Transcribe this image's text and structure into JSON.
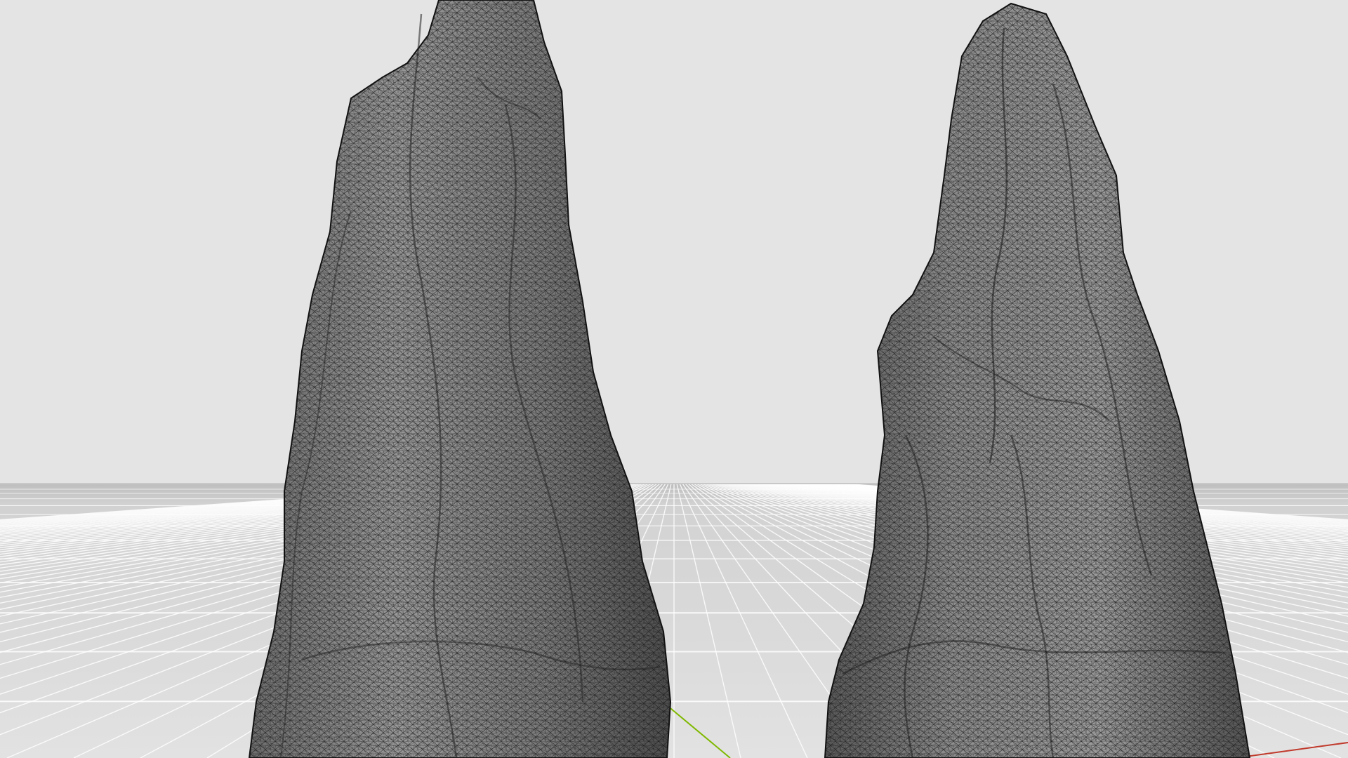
{
  "viewport": {
    "view_mode": "wireframe-shaded",
    "background_color": "#e4e4e4",
    "ground_color": "#d6d6d6",
    "grid_line_color": "#ffffff",
    "mesh_fill_color": "#8c8c8c",
    "mesh_wire_color": "#141414",
    "axes": {
      "x_axis_color": "#c0392b",
      "y_axis_color": "#7fb800"
    },
    "objects": [
      {
        "name": "rock-mesh-left",
        "kind": "scanned rock mesh"
      },
      {
        "name": "rock-mesh-right",
        "kind": "scanned rock mesh"
      }
    ]
  }
}
